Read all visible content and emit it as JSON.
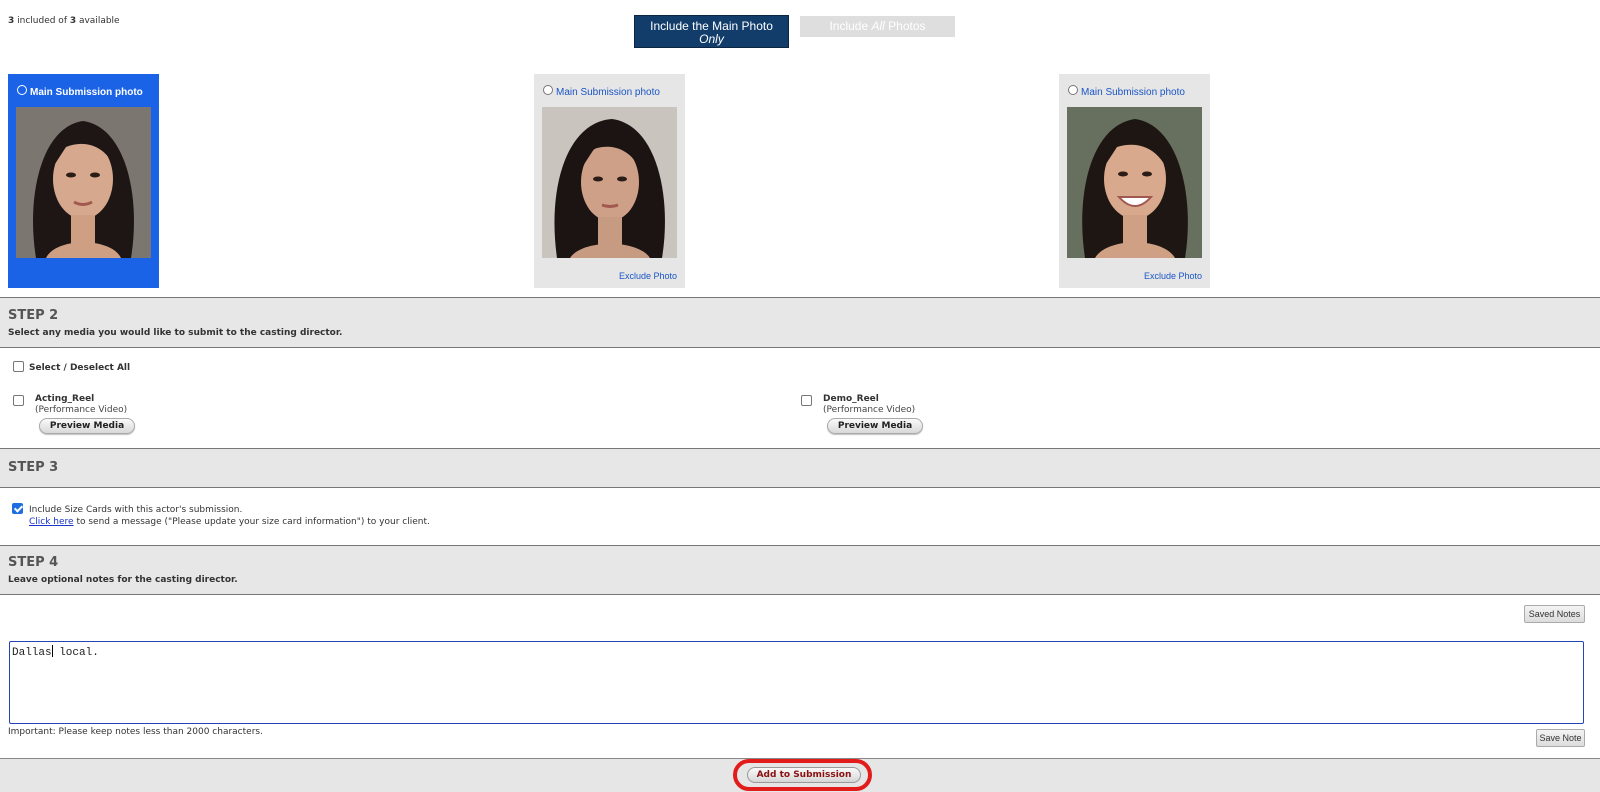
{
  "top": {
    "included_count": "3",
    "included_text": " included of ",
    "available_count": "3",
    "available_text": " available",
    "main_only_line1": "Include the Main Photo",
    "main_only_line2": "Only",
    "all_photos_pre": "Include ",
    "all_photos_em": "All",
    "all_photos_post": " Photos"
  },
  "photos": [
    {
      "caption": "Main Submission photo",
      "selected": true,
      "exclude": ""
    },
    {
      "caption": "Main Submission photo",
      "selected": false,
      "exclude": "Exclude Photo"
    },
    {
      "caption": "Main Submission photo",
      "selected": false,
      "exclude": "Exclude Photo"
    }
  ],
  "step2": {
    "title": "STEP 2",
    "subtitle": "Select any media you would like to submit to the casting director.",
    "select_all": "Select / Deselect All",
    "media": [
      {
        "name": "Acting_Reel",
        "type": "(Performance Video)",
        "button": "Preview Media",
        "checked": false
      },
      {
        "name": "Demo_Reel",
        "type": "(Performance Video)",
        "button": "Preview Media",
        "checked": false
      }
    ]
  },
  "step3": {
    "title": "STEP 3",
    "size_cards_label": "Include Size Cards with this actor's submission.",
    "size_cards_checked": true,
    "click_here": "Click here",
    "click_here_rest": " to send a message (\"Please update your size card information\") to your client."
  },
  "step4": {
    "title": "STEP 4",
    "subtitle": "Leave optional notes for the casting director.",
    "saved_notes": "Saved Notes",
    "notes_before_caret": "Dallas",
    "notes_after_caret": " local.",
    "important": "Important: Please keep notes less than 2000 characters.",
    "save_note": "Save Note"
  },
  "footer": {
    "add_to_submission": "Add to Submission"
  },
  "colors": {
    "main_button": "#123d6b",
    "selected_card": "#1b63e6",
    "link_blue": "#1a55c6",
    "highlight_ring": "#e21b1b",
    "band_grey": "#e7e7e7"
  }
}
